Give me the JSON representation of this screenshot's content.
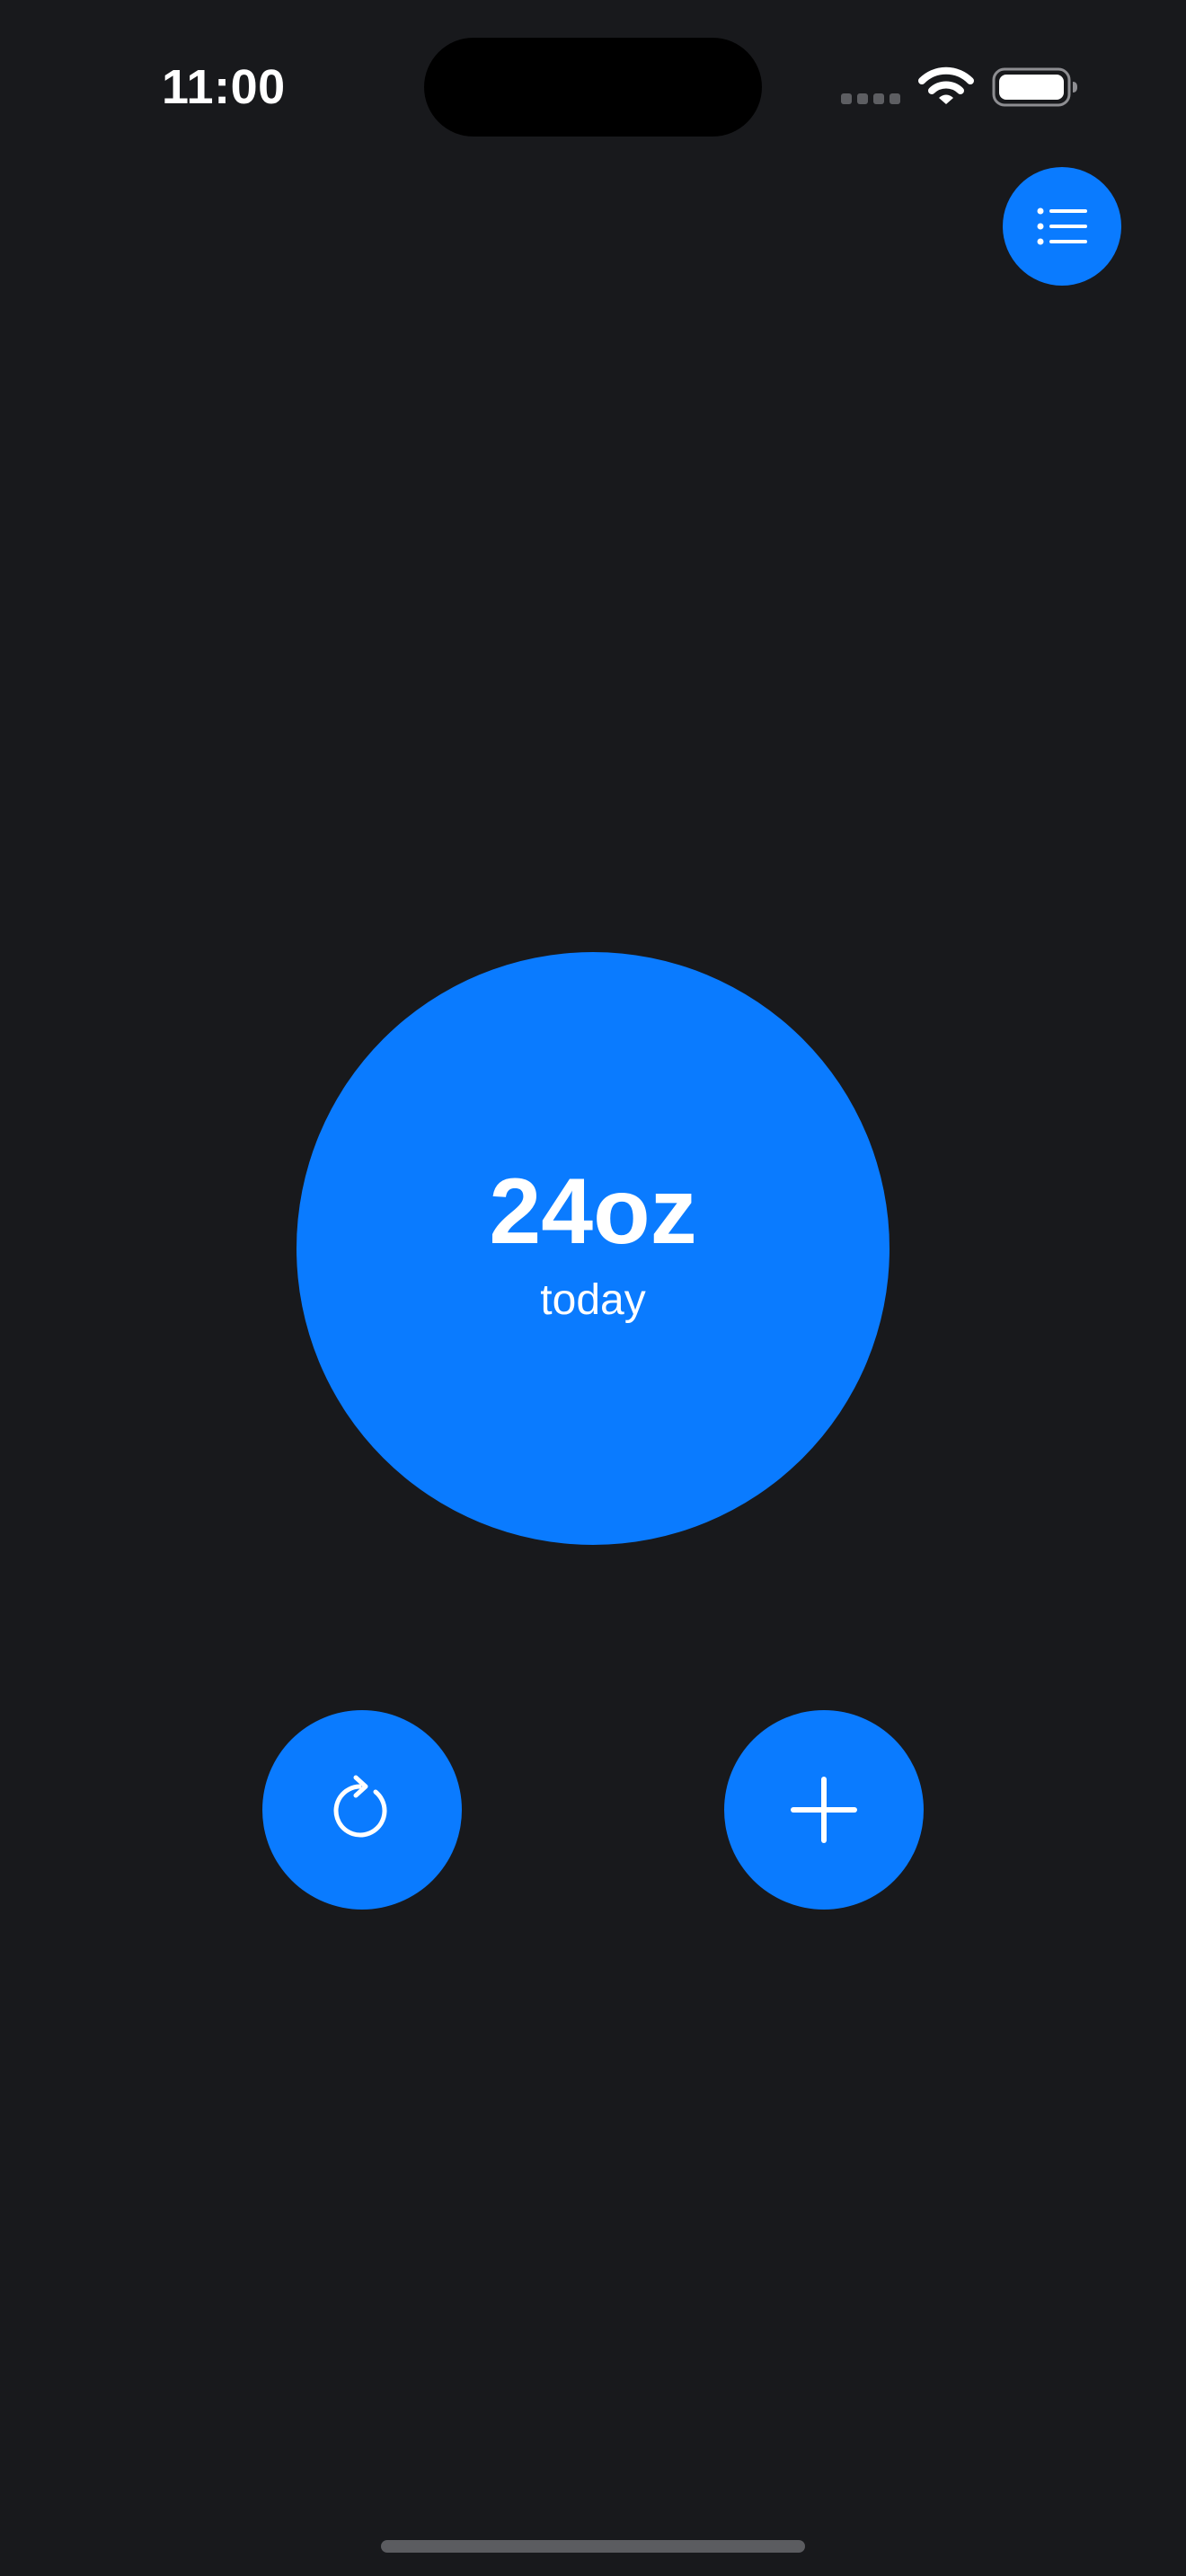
{
  "status_bar": {
    "time": "11:00",
    "signal_icon": "cellular-signal-icon",
    "wifi_icon": "wifi-icon",
    "battery_icon": "battery-icon"
  },
  "header": {
    "menu_icon": "list-icon"
  },
  "tracker": {
    "total": "24oz",
    "label": "today"
  },
  "actions": {
    "reset_icon": "reset-icon",
    "add_icon": "plus-icon"
  },
  "colors": {
    "background": "#18191c",
    "accent": "#0a7bff",
    "text": "#ffffff"
  }
}
